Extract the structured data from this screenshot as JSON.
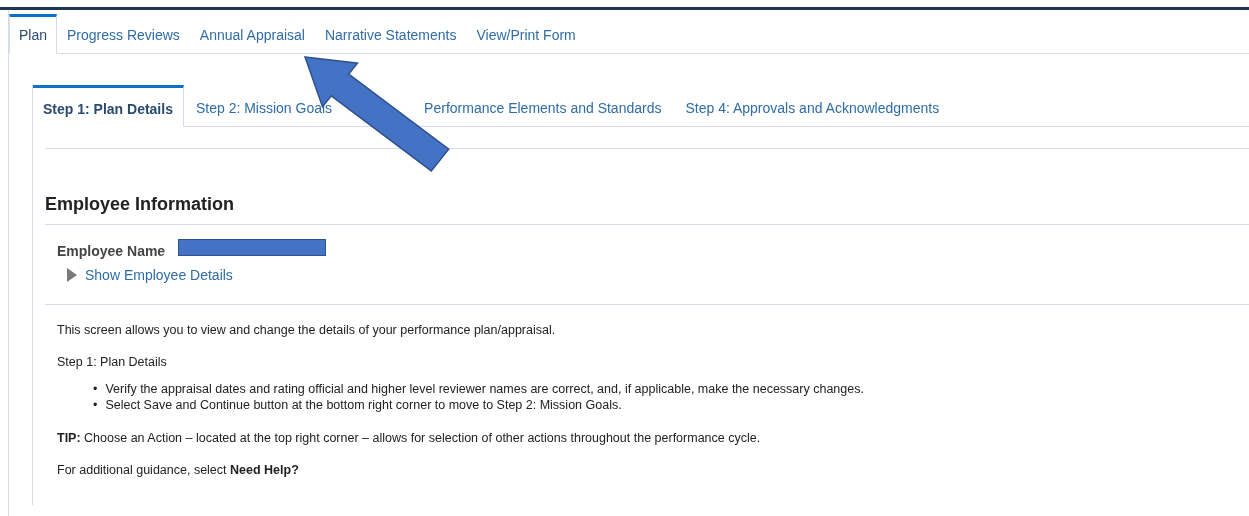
{
  "tabs": [
    {
      "label": "Plan",
      "selected": true
    },
    {
      "label": "Progress Reviews",
      "selected": false
    },
    {
      "label": "Annual Appraisal",
      "selected": false
    },
    {
      "label": "Narrative Statements",
      "selected": false
    },
    {
      "label": "View/Print Form",
      "selected": false
    }
  ],
  "step_tabs": [
    {
      "label": "Step 1: Plan Details",
      "selected": true
    },
    {
      "label": "Step 2: Mission Goals",
      "selected": false
    },
    {
      "label": "Performance Elements and Standards",
      "selected": false
    },
    {
      "label": "Step 4: Approvals and Acknowledgments",
      "selected": false
    }
  ],
  "section": {
    "title": "Employee Information",
    "employee_name_label": "Employee Name",
    "details_toggle": {
      "label": "Show Employee Details",
      "expanded": false
    }
  },
  "instructions": {
    "intro": "This screen allows you to view and change the details of your performance plan/appraisal.",
    "step_heading": "Step 1: Plan Details",
    "bullets": [
      {
        "marker": "•",
        "text": "Verify the appraisal dates and rating official and higher level reviewer names are correct, and, if applicable, make the necessary changes."
      },
      {
        "marker": "•",
        "text": "Select Save and Continue button at the bottom right corner to move to Step 2: Mission Goals."
      }
    ],
    "tip": "**TIP:** Choose an Action – located at the top right corner – allows for selection of other actions throughout the performance cycle.",
    "help": "For additional guidance, select  **Need Help?**"
  }
}
